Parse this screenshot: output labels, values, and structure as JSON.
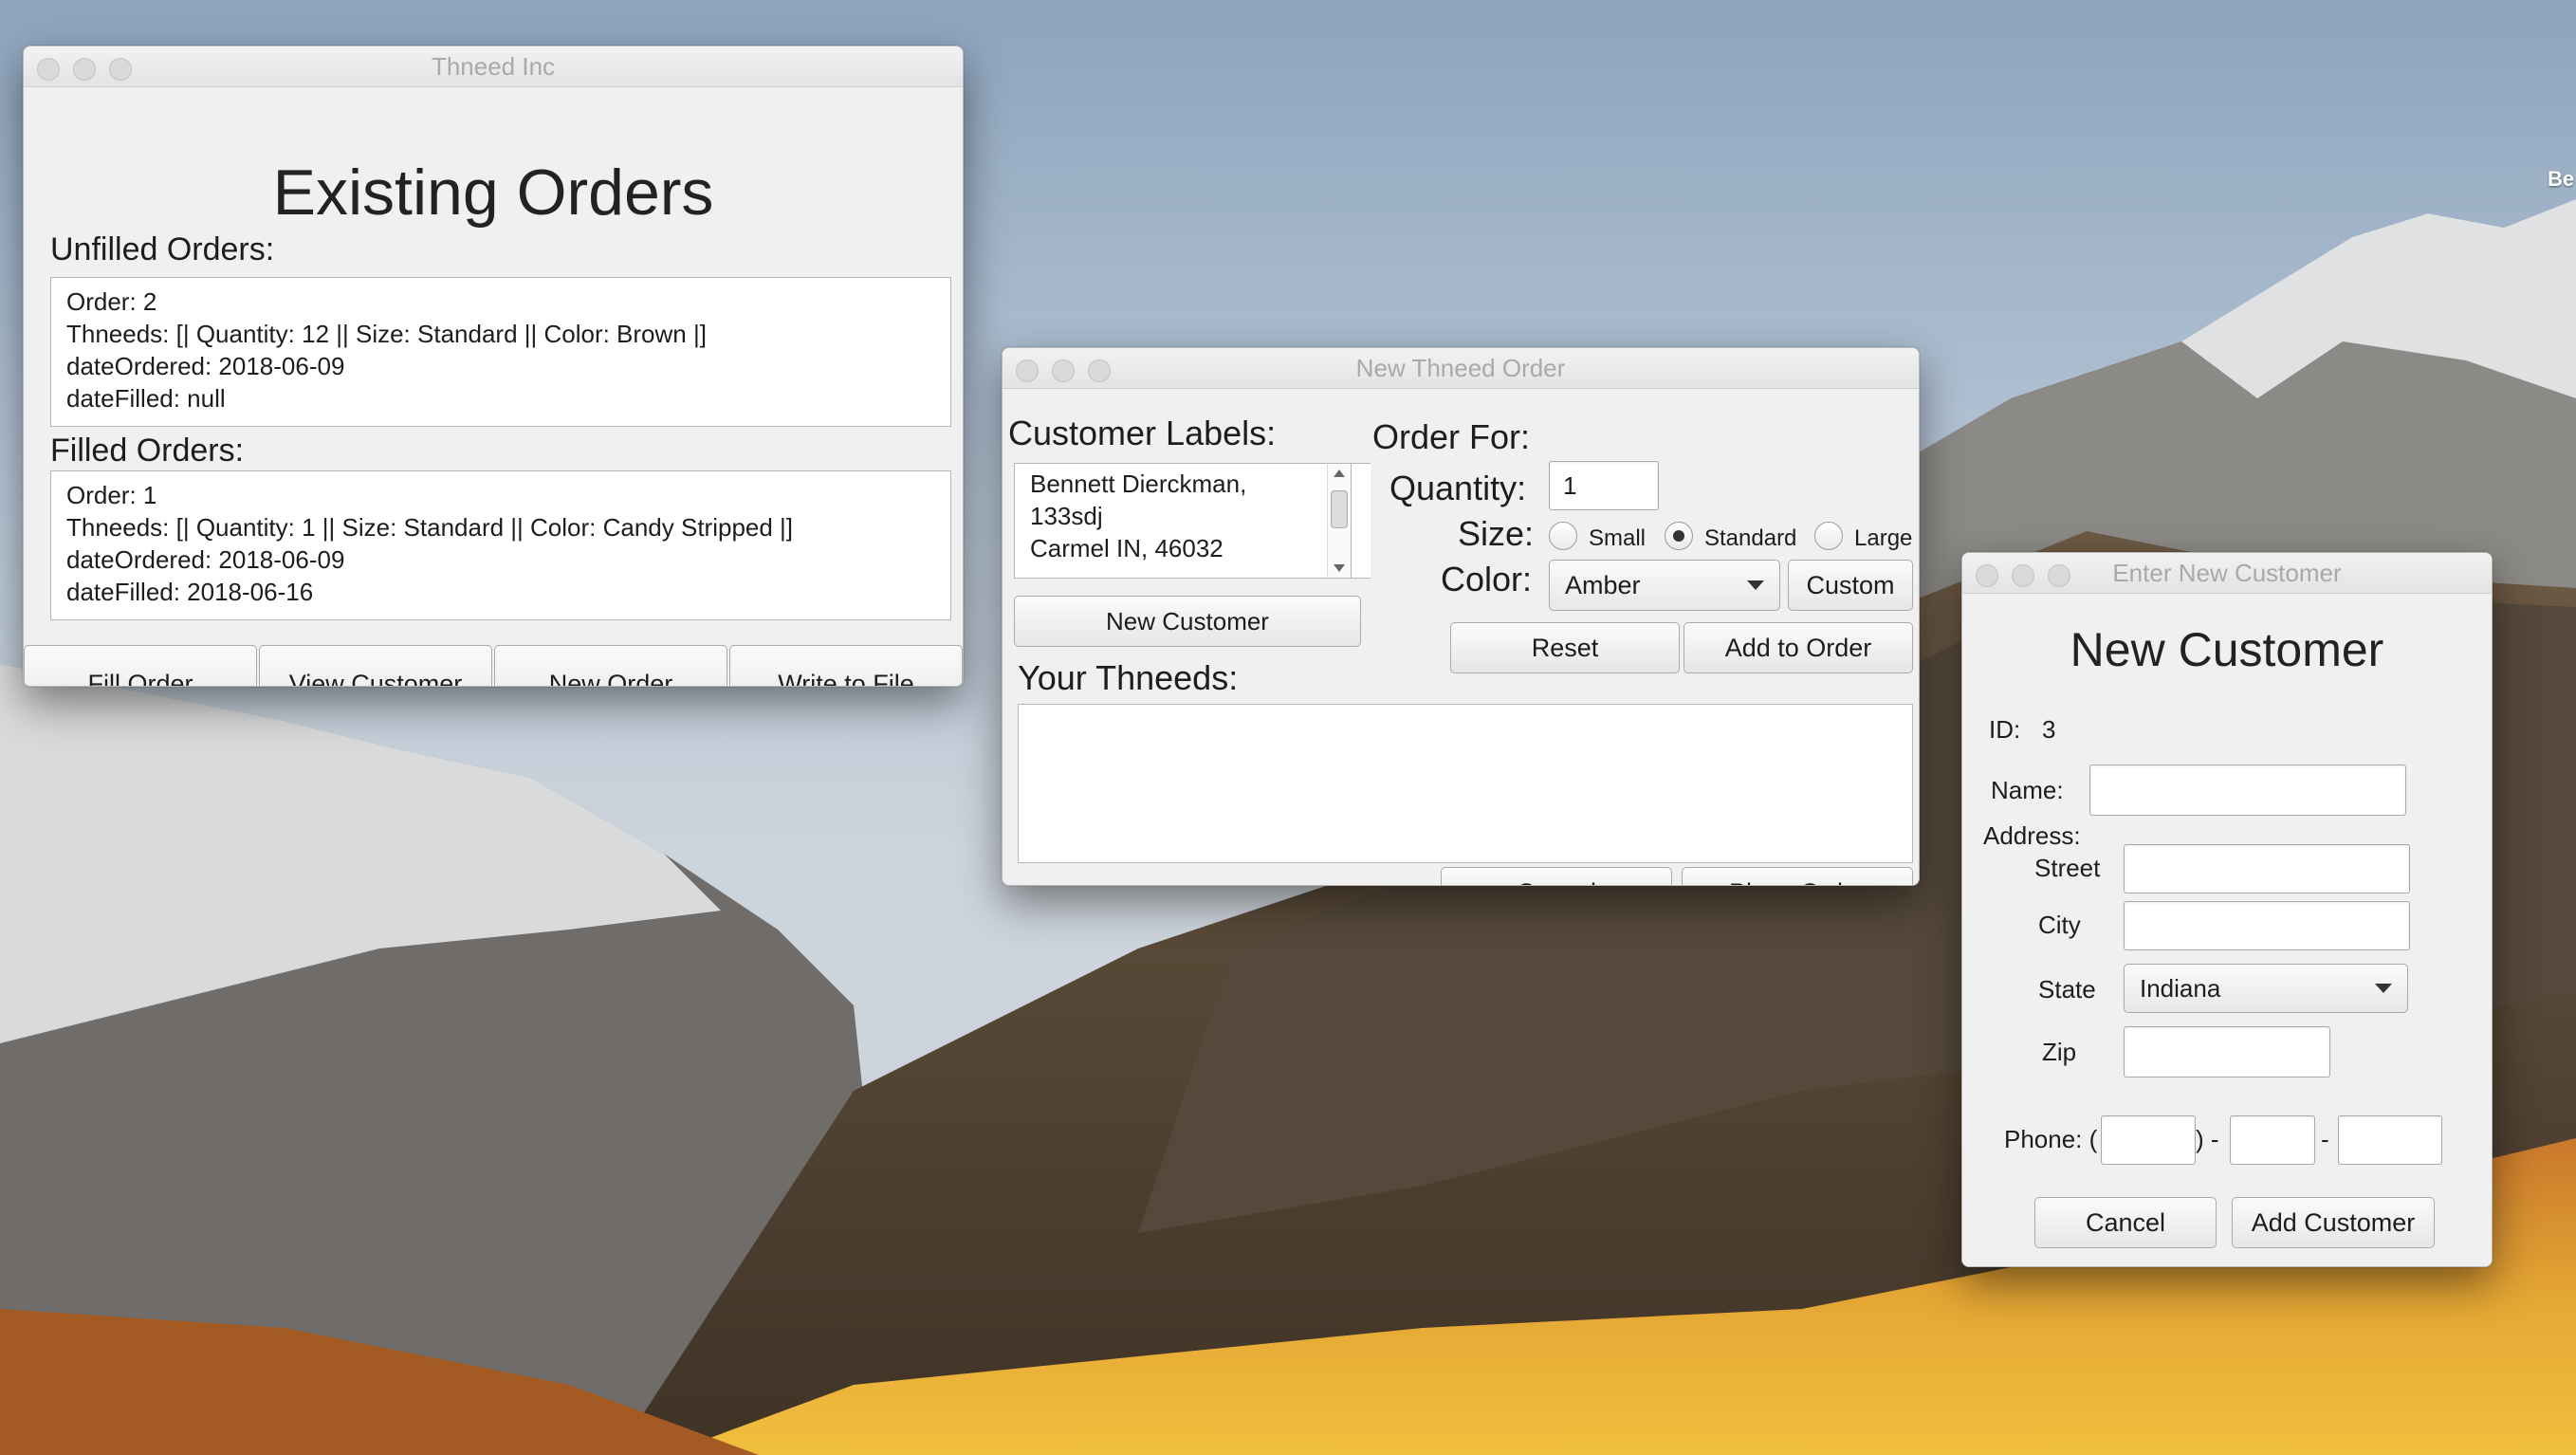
{
  "desktop": {
    "edge_text": "Be"
  },
  "orders_window": {
    "title": "Thneed Inc",
    "heading": "Existing Orders",
    "unfilled_label": "Unfilled Orders:",
    "unfilled_text": "Order: 2\nThneeds: [| Quantity: 12 || Size: Standard || Color: Brown |]\ndateOrdered: 2018-06-09\ndateFilled: null",
    "filled_label": "Filled Orders:",
    "filled_text": "Order: 1\nThneeds: [| Quantity: 1 || Size: Standard || Color: Candy Stripped |]\ndateOrdered: 2018-06-09\ndateFilled: 2018-06-16",
    "buttons": {
      "fill_order": "Fill Order",
      "view_customer": "View Customer",
      "new_order": "New Order",
      "write_to_file": "Write to File"
    }
  },
  "order_window": {
    "title": "New Thneed Order",
    "customer_labels": "Customer Labels:",
    "customer_text": "Bennett Dierckman,\n133sdj\nCarmel IN, 46032",
    "new_customer_button": "New Customer",
    "order_for": "Order For:",
    "quantity_label": "Quantity:",
    "quantity_value": "1",
    "size_label": "Size:",
    "size_options": [
      "Small",
      "Standard",
      "Large"
    ],
    "size_selected": "Standard",
    "color_label": "Color:",
    "color_value": "Amber",
    "custom_button": "Custom",
    "reset_button": "Reset",
    "add_to_order_button": "Add to Order",
    "your_thneeds": "Your Thneeds:",
    "your_thneeds_text": "",
    "cancel_button": "Cancel",
    "place_order_button": "Place Order"
  },
  "customer_window": {
    "title": "Enter New Customer",
    "heading": "New Customer",
    "id_label": "ID:",
    "id_value": "3",
    "name_label": "Name:",
    "name_value": "",
    "address_label": "Address:",
    "street_label": "Street",
    "street_value": "",
    "city_label": "City",
    "city_value": "",
    "state_label": "State",
    "state_value": "Indiana",
    "zip_label": "Zip",
    "zip_value": "",
    "phone_label": "Phone: (",
    "phone_sep1": ") -",
    "phone_sep2": "-",
    "phone_area": "",
    "phone_prefix": "",
    "phone_line": "",
    "cancel_button": "Cancel",
    "add_button": "Add Customer"
  }
}
